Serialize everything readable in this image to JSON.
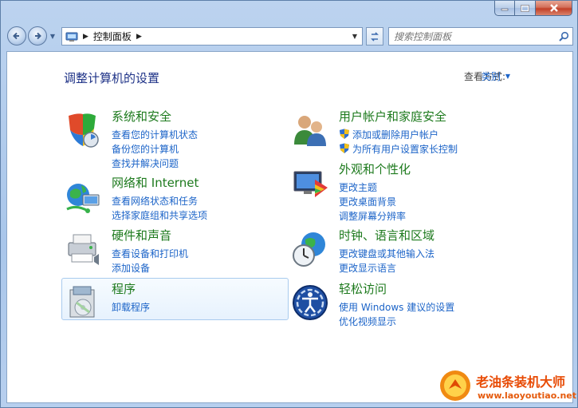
{
  "window": {
    "caption_buttons": [
      "minimize-icon",
      "maximize-icon",
      "close-icon"
    ]
  },
  "navbar": {
    "breadcrumb": "控制面板",
    "search_placeholder": "搜索控制面板"
  },
  "header": {
    "title": "调整计算机的设置",
    "view_by_label": "查看方式:",
    "view_by_value": "类别"
  },
  "categories": [
    {
      "title": "系统和安全",
      "icon": "system-security-icon",
      "links": [
        "查看您的计算机状态",
        "备份您的计算机",
        "查找并解决问题"
      ]
    },
    {
      "title": "网络和 Internet",
      "icon": "network-icon",
      "links": [
        "查看网络状态和任务",
        "选择家庭组和共享选项"
      ]
    },
    {
      "title": "硬件和声音",
      "icon": "hardware-sound-icon",
      "links": [
        "查看设备和打印机",
        "添加设备"
      ]
    },
    {
      "title": "程序",
      "icon": "programs-icon",
      "links": [
        "卸载程序"
      ]
    },
    {
      "title": "用户帐户和家庭安全",
      "icon": "user-accounts-icon",
      "links": [
        "添加或删除用户帐户",
        "为所有用户设置家长控制"
      ]
    },
    {
      "title": "外观和个性化",
      "icon": "appearance-icon",
      "links": [
        "更改主题",
        "更改桌面背景",
        "调整屏幕分辨率"
      ]
    },
    {
      "title": "时钟、语言和区域",
      "icon": "clock-language-icon",
      "links": [
        "更改键盘或其他输入法",
        "更改显示语言"
      ]
    },
    {
      "title": "轻松访问",
      "icon": "ease-of-access-icon",
      "links": [
        "使用 Windows 建议的设置",
        "优化视频显示"
      ]
    }
  ],
  "watermark": {
    "brand": "老油条装机大师",
    "url": "www.laoyoutiao.net"
  },
  "colors": {
    "title_blue": "#1e3287",
    "link_blue": "#1c64c8",
    "category_green": "#1d7a1d",
    "watermark_orange": "#e84b05"
  }
}
